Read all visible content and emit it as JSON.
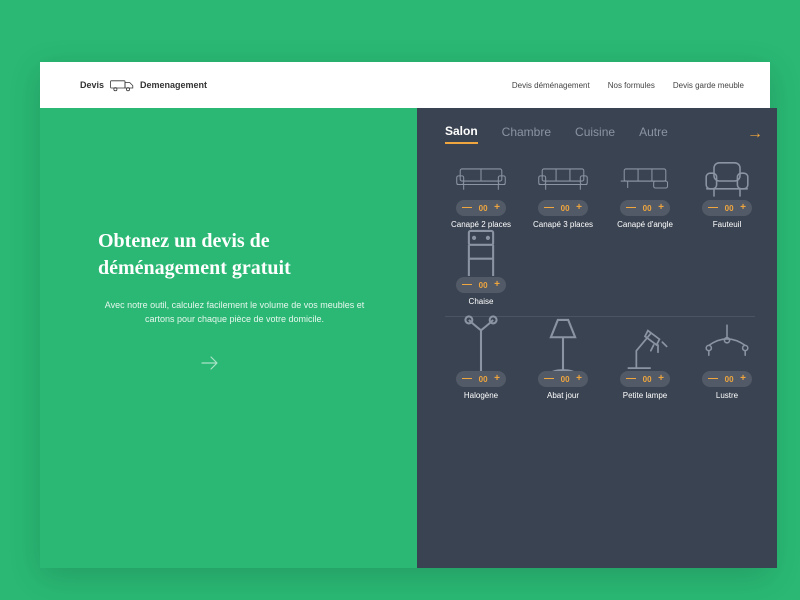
{
  "logo": {
    "left": "Devis",
    "right": "Demenagement"
  },
  "nav": [
    "Devis déménagement",
    "Nos formules",
    "Devis garde meuble"
  ],
  "heading": "Obtenez un devis de déménagement gratuit",
  "subtext": "Avec notre outil, calculez facilement le volume de vos meubles et cartons pour chaque pièce de votre domicile.",
  "tabs": [
    "Salon",
    "Chambre",
    "Cuisine",
    "Autre"
  ],
  "active_tab": 0,
  "section1": [
    {
      "label": "Canapé 2 places",
      "count": "00"
    },
    {
      "label": "Canapé 3 places",
      "count": "00"
    },
    {
      "label": "Canapé d'angle",
      "count": "00"
    },
    {
      "label": "Fauteuil",
      "count": "00"
    },
    {
      "label": "Chaise",
      "count": "00"
    }
  ],
  "section2": [
    {
      "label": "Halogène",
      "count": "00"
    },
    {
      "label": "Abat jour",
      "count": "00"
    },
    {
      "label": "Petite lampe",
      "count": "00"
    },
    {
      "label": "Lustre",
      "count": "00"
    }
  ],
  "stepper": {
    "minus": "—",
    "plus": "+"
  },
  "colors": {
    "accent": "#f0a63e",
    "panel": "#3a4351",
    "brand": "#2ab874"
  }
}
